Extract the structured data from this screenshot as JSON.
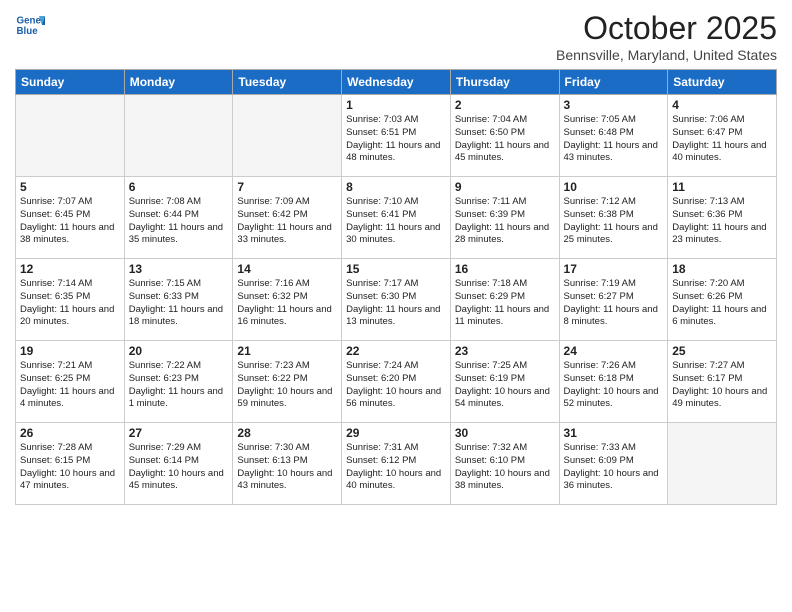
{
  "logo": {
    "line1": "General",
    "line2": "Blue"
  },
  "title": "October 2025",
  "subtitle": "Bennsville, Maryland, United States",
  "days_of_week": [
    "Sunday",
    "Monday",
    "Tuesday",
    "Wednesday",
    "Thursday",
    "Friday",
    "Saturday"
  ],
  "weeks": [
    [
      {
        "day": "",
        "info": ""
      },
      {
        "day": "",
        "info": ""
      },
      {
        "day": "",
        "info": ""
      },
      {
        "day": "1",
        "info": "Sunrise: 7:03 AM\nSunset: 6:51 PM\nDaylight: 11 hours\nand 48 minutes."
      },
      {
        "day": "2",
        "info": "Sunrise: 7:04 AM\nSunset: 6:50 PM\nDaylight: 11 hours\nand 45 minutes."
      },
      {
        "day": "3",
        "info": "Sunrise: 7:05 AM\nSunset: 6:48 PM\nDaylight: 11 hours\nand 43 minutes."
      },
      {
        "day": "4",
        "info": "Sunrise: 7:06 AM\nSunset: 6:47 PM\nDaylight: 11 hours\nand 40 minutes."
      }
    ],
    [
      {
        "day": "5",
        "info": "Sunrise: 7:07 AM\nSunset: 6:45 PM\nDaylight: 11 hours\nand 38 minutes."
      },
      {
        "day": "6",
        "info": "Sunrise: 7:08 AM\nSunset: 6:44 PM\nDaylight: 11 hours\nand 35 minutes."
      },
      {
        "day": "7",
        "info": "Sunrise: 7:09 AM\nSunset: 6:42 PM\nDaylight: 11 hours\nand 33 minutes."
      },
      {
        "day": "8",
        "info": "Sunrise: 7:10 AM\nSunset: 6:41 PM\nDaylight: 11 hours\nand 30 minutes."
      },
      {
        "day": "9",
        "info": "Sunrise: 7:11 AM\nSunset: 6:39 PM\nDaylight: 11 hours\nand 28 minutes."
      },
      {
        "day": "10",
        "info": "Sunrise: 7:12 AM\nSunset: 6:38 PM\nDaylight: 11 hours\nand 25 minutes."
      },
      {
        "day": "11",
        "info": "Sunrise: 7:13 AM\nSunset: 6:36 PM\nDaylight: 11 hours\nand 23 minutes."
      }
    ],
    [
      {
        "day": "12",
        "info": "Sunrise: 7:14 AM\nSunset: 6:35 PM\nDaylight: 11 hours\nand 20 minutes."
      },
      {
        "day": "13",
        "info": "Sunrise: 7:15 AM\nSunset: 6:33 PM\nDaylight: 11 hours\nand 18 minutes."
      },
      {
        "day": "14",
        "info": "Sunrise: 7:16 AM\nSunset: 6:32 PM\nDaylight: 11 hours\nand 16 minutes."
      },
      {
        "day": "15",
        "info": "Sunrise: 7:17 AM\nSunset: 6:30 PM\nDaylight: 11 hours\nand 13 minutes."
      },
      {
        "day": "16",
        "info": "Sunrise: 7:18 AM\nSunset: 6:29 PM\nDaylight: 11 hours\nand 11 minutes."
      },
      {
        "day": "17",
        "info": "Sunrise: 7:19 AM\nSunset: 6:27 PM\nDaylight: 11 hours\nand 8 minutes."
      },
      {
        "day": "18",
        "info": "Sunrise: 7:20 AM\nSunset: 6:26 PM\nDaylight: 11 hours\nand 6 minutes."
      }
    ],
    [
      {
        "day": "19",
        "info": "Sunrise: 7:21 AM\nSunset: 6:25 PM\nDaylight: 11 hours\nand 4 minutes."
      },
      {
        "day": "20",
        "info": "Sunrise: 7:22 AM\nSunset: 6:23 PM\nDaylight: 11 hours\nand 1 minute."
      },
      {
        "day": "21",
        "info": "Sunrise: 7:23 AM\nSunset: 6:22 PM\nDaylight: 10 hours\nand 59 minutes."
      },
      {
        "day": "22",
        "info": "Sunrise: 7:24 AM\nSunset: 6:20 PM\nDaylight: 10 hours\nand 56 minutes."
      },
      {
        "day": "23",
        "info": "Sunrise: 7:25 AM\nSunset: 6:19 PM\nDaylight: 10 hours\nand 54 minutes."
      },
      {
        "day": "24",
        "info": "Sunrise: 7:26 AM\nSunset: 6:18 PM\nDaylight: 10 hours\nand 52 minutes."
      },
      {
        "day": "25",
        "info": "Sunrise: 7:27 AM\nSunset: 6:17 PM\nDaylight: 10 hours\nand 49 minutes."
      }
    ],
    [
      {
        "day": "26",
        "info": "Sunrise: 7:28 AM\nSunset: 6:15 PM\nDaylight: 10 hours\nand 47 minutes."
      },
      {
        "day": "27",
        "info": "Sunrise: 7:29 AM\nSunset: 6:14 PM\nDaylight: 10 hours\nand 45 minutes."
      },
      {
        "day": "28",
        "info": "Sunrise: 7:30 AM\nSunset: 6:13 PM\nDaylight: 10 hours\nand 43 minutes."
      },
      {
        "day": "29",
        "info": "Sunrise: 7:31 AM\nSunset: 6:12 PM\nDaylight: 10 hours\nand 40 minutes."
      },
      {
        "day": "30",
        "info": "Sunrise: 7:32 AM\nSunset: 6:10 PM\nDaylight: 10 hours\nand 38 minutes."
      },
      {
        "day": "31",
        "info": "Sunrise: 7:33 AM\nSunset: 6:09 PM\nDaylight: 10 hours\nand 36 minutes."
      },
      {
        "day": "",
        "info": ""
      }
    ]
  ]
}
